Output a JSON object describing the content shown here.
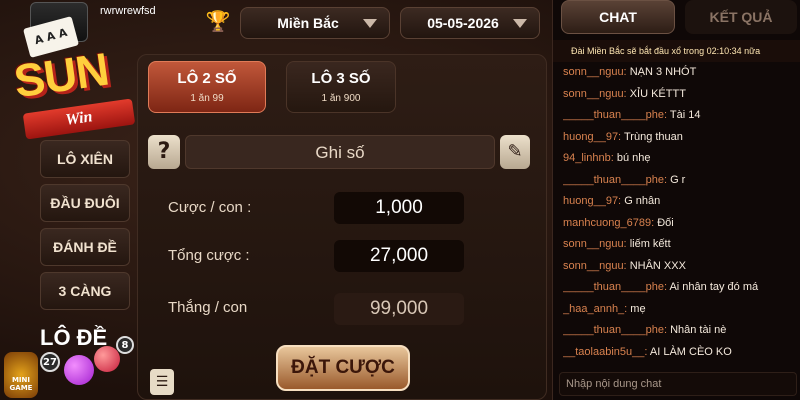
{
  "header": {
    "username": "rwrwrewfsd",
    "region": "Miền Bắc",
    "date": "05-05-2026"
  },
  "logo": {
    "text": "SUN",
    "ribbon": "Win",
    "cards": "A A A"
  },
  "sidebar": {
    "items": [
      {
        "label": "LÔ XIÊN"
      },
      {
        "label": "ĐẦU ĐUÔI"
      },
      {
        "label": "ĐÁNH ĐỀ"
      },
      {
        "label": "3 CÀNG"
      }
    ],
    "lode_title": "LÔ ĐỀ",
    "balls": [
      "27",
      "",
      "",
      "8"
    ],
    "minigame_label": "MINI GAME"
  },
  "main": {
    "tabs": [
      {
        "label": "LÔ 2 SỐ",
        "sub": "1 ăn 99"
      },
      {
        "label": "LÔ 3 SỐ",
        "sub": "1 ăn 900"
      }
    ],
    "help_symbol": "?",
    "input_placeholder": "Ghi số",
    "rows": [
      {
        "label": "Cược / con :",
        "value": "1,000"
      },
      {
        "label": "Tổng cược :",
        "value": "27,000"
      },
      {
        "label": "Thắng / con",
        "value": "99,000"
      }
    ],
    "bet_button": "ĐẶT CƯỢC"
  },
  "chat": {
    "tabs": [
      "CHAT",
      "KẾT QUẢ"
    ],
    "announcement": "Đài Miền Bắc sẽ bắt đầu xổ trong 02:10:34 nữa",
    "messages": [
      {
        "user": "sonn__nguu:",
        "text": "NẠN 3 NHÓT"
      },
      {
        "user": "sonn__nguu:",
        "text": "XỈU KÉTTT"
      },
      {
        "user": "_____thuan____phe:",
        "text": "Tài 14"
      },
      {
        "user": "huong__97:",
        "text": "Trùng thuan"
      },
      {
        "user": "94_linhnb:",
        "text": "bú nhẹ"
      },
      {
        "user": "_____thuan____phe:",
        "text": "G r"
      },
      {
        "user": "huong__97:",
        "text": "G nhân"
      },
      {
        "user": "manhcuong_6789:",
        "text": "Đối"
      },
      {
        "user": "sonn__nguu:",
        "text": "liếm kếtt"
      },
      {
        "user": "sonn__nguu:",
        "text": "NHÂN XXX"
      },
      {
        "user": "_____thuan____phe:",
        "text": "Ai nhân tay đó má"
      },
      {
        "user": "_haa_annh_:",
        "text": "mẹ"
      },
      {
        "user": "_____thuan____phe:",
        "text": "Nhân tài nè"
      },
      {
        "user": "__taolaabin5u__:",
        "text": "AI LÀM CÈO KO"
      }
    ],
    "input_placeholder": "Nhập nội dung chat"
  }
}
